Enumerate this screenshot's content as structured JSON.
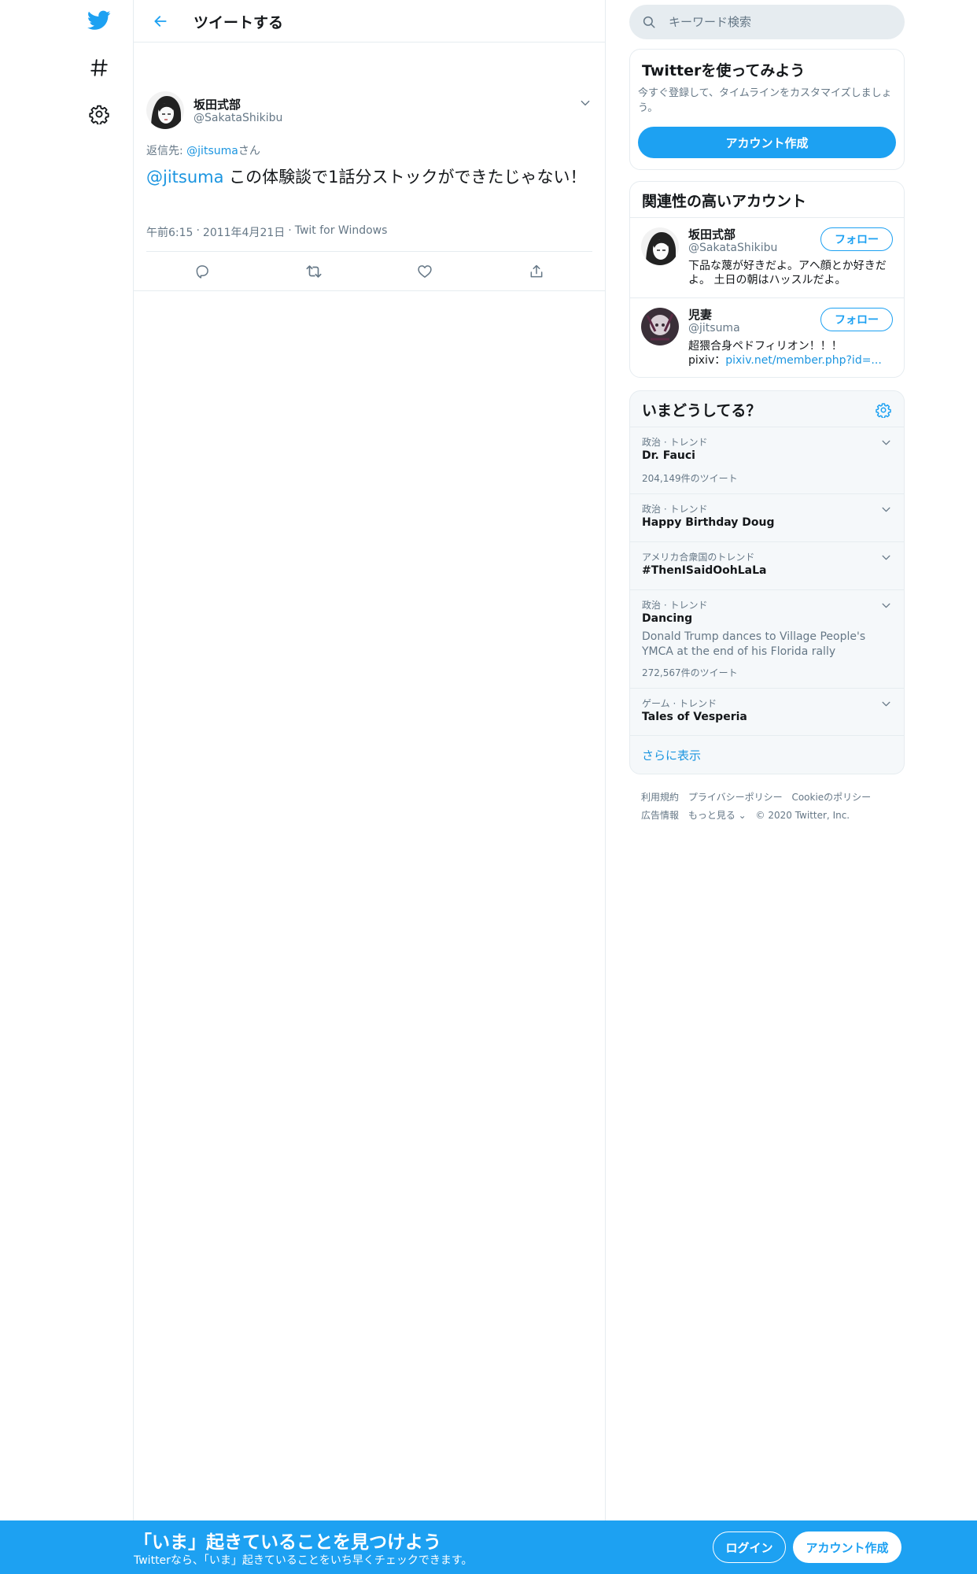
{
  "colors": {
    "brand": "#1da1f2",
    "link": "#1b95e0",
    "muted": "#657786",
    "text": "#14171a",
    "border": "#e6ecf0"
  },
  "nav": {
    "icons": [
      "twitter-logo-icon",
      "hashtag-icon",
      "gear-icon"
    ]
  },
  "header": {
    "title": "ツイートする"
  },
  "tweet": {
    "author_name": "坂田式部",
    "author_handle": "@SakataShikibu",
    "reply_prefix": "返信先: ",
    "reply_handle": "@jitsuma",
    "reply_suffix": "さん",
    "mention": "@jitsuma",
    "text": " この体験談で1話分ストックができたじゃない！",
    "time": "午前6:15",
    "date": "2011年4月21日",
    "source": "Twit for Windows",
    "separator": "·"
  },
  "search": {
    "placeholder": "キーワード検索"
  },
  "signup_card": {
    "title": "Twitterを使ってみよう",
    "description": "今すぐ登録して、タイムラインをカスタマイズしましょう。",
    "button": "アカウント作成"
  },
  "related": {
    "title": "関連性の高いアカウント",
    "follow_label": "フォロー",
    "accounts": [
      {
        "name": "坂田式部",
        "handle": "@SakataShikibu",
        "bio": "下品な蔑が好きだよ。アヘ顔とか好きだよ。 土日の朝はハッスルだよ。",
        "bio_link": ""
      },
      {
        "name": "児妻",
        "handle": "@jitsuma",
        "bio": "超猥合身ペドフィリオン！！！",
        "bio_prefix": "pixiv：",
        "bio_link": "pixiv.net/member.php?id=..."
      }
    ]
  },
  "trends": {
    "title": "いまどうしてる？",
    "items": [
      {
        "category": "政治 · トレンド",
        "name": "Dr. Fauci",
        "description": "",
        "count": "204,149件のツイート"
      },
      {
        "category": "政治 · トレンド",
        "name": "Happy Birthday Doug",
        "description": "",
        "count": ""
      },
      {
        "category": "アメリカ合衆国のトレンド",
        "name": "#ThenISaidOohLaLa",
        "description": "",
        "count": ""
      },
      {
        "category": "政治 · トレンド",
        "name": "Dancing",
        "description": "Donald Trump dances to Village People's YMCA at the end of his Florida rally",
        "count": "272,567件のツイート"
      },
      {
        "category": "ゲーム · トレンド",
        "name": "Tales of Vesperia",
        "description": "",
        "count": ""
      }
    ],
    "show_more": "さらに表示"
  },
  "footer": {
    "links": [
      "利用規約",
      "プライバシーポリシー",
      "Cookieのポリシー",
      "広告情報",
      "もっと見る ⌄",
      "© 2020 Twitter, Inc."
    ]
  },
  "bottom_bar": {
    "title": "「いま」起きていることを見つけよう",
    "subtitle": "Twitterなら、「いま」起きていることをいち早くチェックできます。",
    "login": "ログイン",
    "signup": "アカウント作成"
  }
}
